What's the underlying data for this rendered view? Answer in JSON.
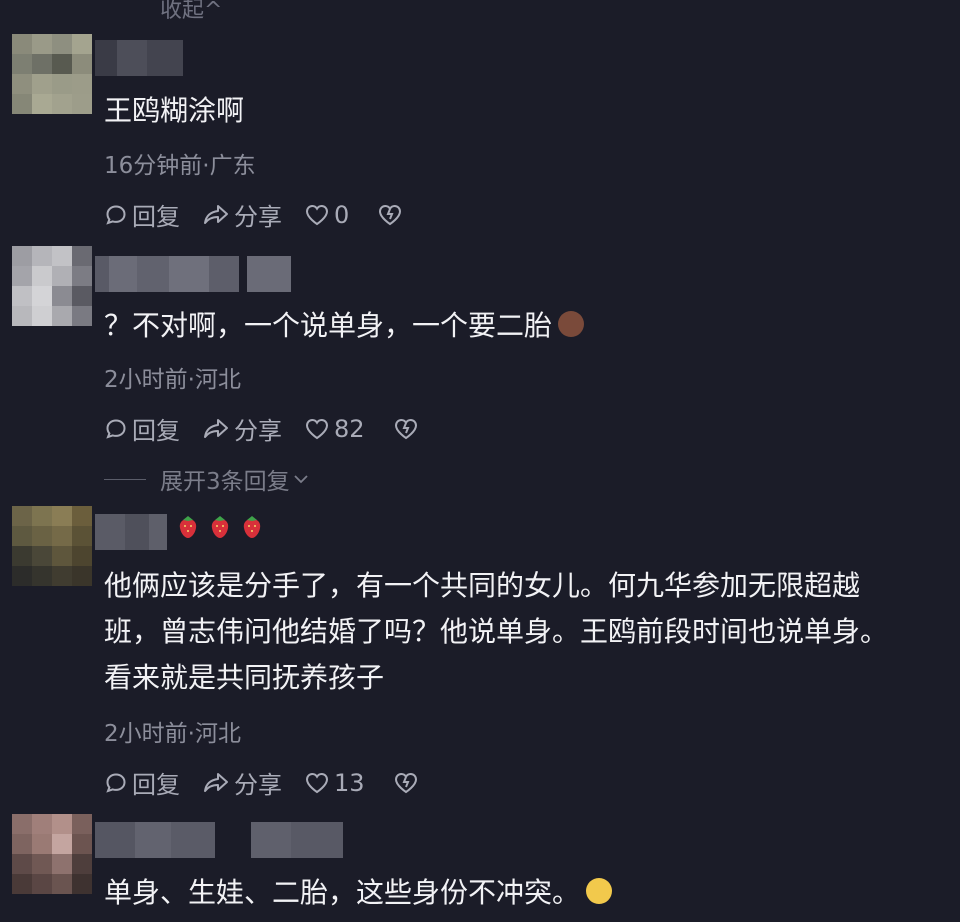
{
  "collapse_label": "收起",
  "comments": [
    {
      "text": "王鸥糊涂啊",
      "meta": "16分钟前·广东",
      "reply_label": "回复",
      "share_label": "分享",
      "like_count": "0"
    },
    {
      "text": "？不对啊，一个说单身，一个要二胎",
      "meta": "2小时前·河北",
      "reply_label": "回复",
      "share_label": "分享",
      "like_count": "82",
      "expand_label": "展开3条回复"
    },
    {
      "lines": [
        "他俩应该是分手了，有一个共同的女儿。何九华参加无限超越",
        "班，曾志伟问他结婚了吗？他说单身。王鸥前段时间也说单身。",
        "看来就是共同抚养孩子"
      ],
      "meta": "2小时前·河北",
      "reply_label": "回复",
      "share_label": "分享",
      "like_count": "13"
    },
    {
      "text": "单身、生娃、二胎，这些身份不冲突。"
    }
  ]
}
